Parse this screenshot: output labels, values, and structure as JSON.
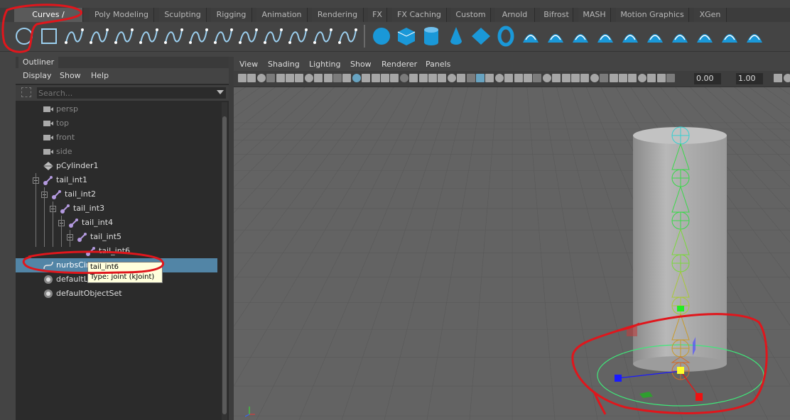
{
  "shelf": {
    "tabs": [
      {
        "label": "Curves / Surfaces",
        "active": true
      },
      {
        "label": "Poly Modeling"
      },
      {
        "label": "Sculpting"
      },
      {
        "label": "Rigging"
      },
      {
        "label": "Animation"
      },
      {
        "label": "Rendering"
      },
      {
        "label": "FX"
      },
      {
        "label": "FX Caching"
      },
      {
        "label": "Custom"
      },
      {
        "label": "Arnold"
      },
      {
        "label": "Bifrost"
      },
      {
        "label": "MASH"
      },
      {
        "label": "Motion Graphics"
      },
      {
        "label": "XGen"
      }
    ],
    "tools": [
      "nurbs-circle-icon",
      "nurbs-square-icon",
      "cv-curve-icon",
      "pencil-curve-icon",
      "ep-curve-icon",
      "bezier-curve-icon",
      "cut-curve-icon",
      "extend-curve-icon",
      "curve-edit-icon",
      "arc-tool-icon",
      "attach-curves-icon",
      "offset-curve-icon",
      "rebuild-curve-icon",
      "reverse-curve-icon",
      "nurbs-sphere-icon",
      "nurbs-cube-icon",
      "nurbs-cylinder-icon",
      "nurbs-cone-icon",
      "nurbs-plane-icon",
      "nurbs-torus-icon",
      "revolve-icon",
      "loft-icon",
      "planar-icon",
      "extrude-icon",
      "birail-icon",
      "boundary-icon",
      "square-surface-icon",
      "project-curve-icon",
      "trim-icon",
      "untrim-icon"
    ]
  },
  "outliner": {
    "tab_label": "Outliner",
    "menu": [
      "Display",
      "Show",
      "Help"
    ],
    "search_placeholder": "Search...",
    "items": [
      {
        "label": "persp",
        "icon": "camera-icon",
        "dim": true
      },
      {
        "label": "top",
        "icon": "camera-icon",
        "dim": true
      },
      {
        "label": "front",
        "icon": "camera-icon",
        "dim": true
      },
      {
        "label": "side",
        "icon": "camera-icon",
        "dim": true
      },
      {
        "label": "pCylinder1",
        "icon": "mesh-icon"
      },
      {
        "label": "tail_int1",
        "icon": "joint-icon"
      },
      {
        "label": "tail_int2",
        "icon": "joint-icon"
      },
      {
        "label": "tail_int3",
        "icon": "joint-icon"
      },
      {
        "label": "tail_int4",
        "icon": "joint-icon"
      },
      {
        "label": "tail_int5",
        "icon": "joint-icon"
      },
      {
        "label": "tail_int6",
        "icon": "joint-icon"
      },
      {
        "label": "nurbsCircle1",
        "icon": "curve-icon",
        "selected": true
      },
      {
        "label": "defaultLightSet",
        "icon": "set-icon"
      },
      {
        "label": "defaultObjectSet",
        "icon": "set-icon"
      }
    ],
    "tooltip": {
      "title": "tail_int6",
      "subtitle": "Type: joint (kJoint)"
    }
  },
  "viewport": {
    "menu": [
      "View",
      "Shading",
      "Lighting",
      "Show",
      "Renderer",
      "Panels"
    ],
    "exposure": "0.00",
    "gamma": "1.00"
  },
  "colors": {
    "selection": "#5285a6",
    "annotation": "#e0161c",
    "tab_active": "#5a5a5a",
    "viewport_bg": "#636363"
  }
}
